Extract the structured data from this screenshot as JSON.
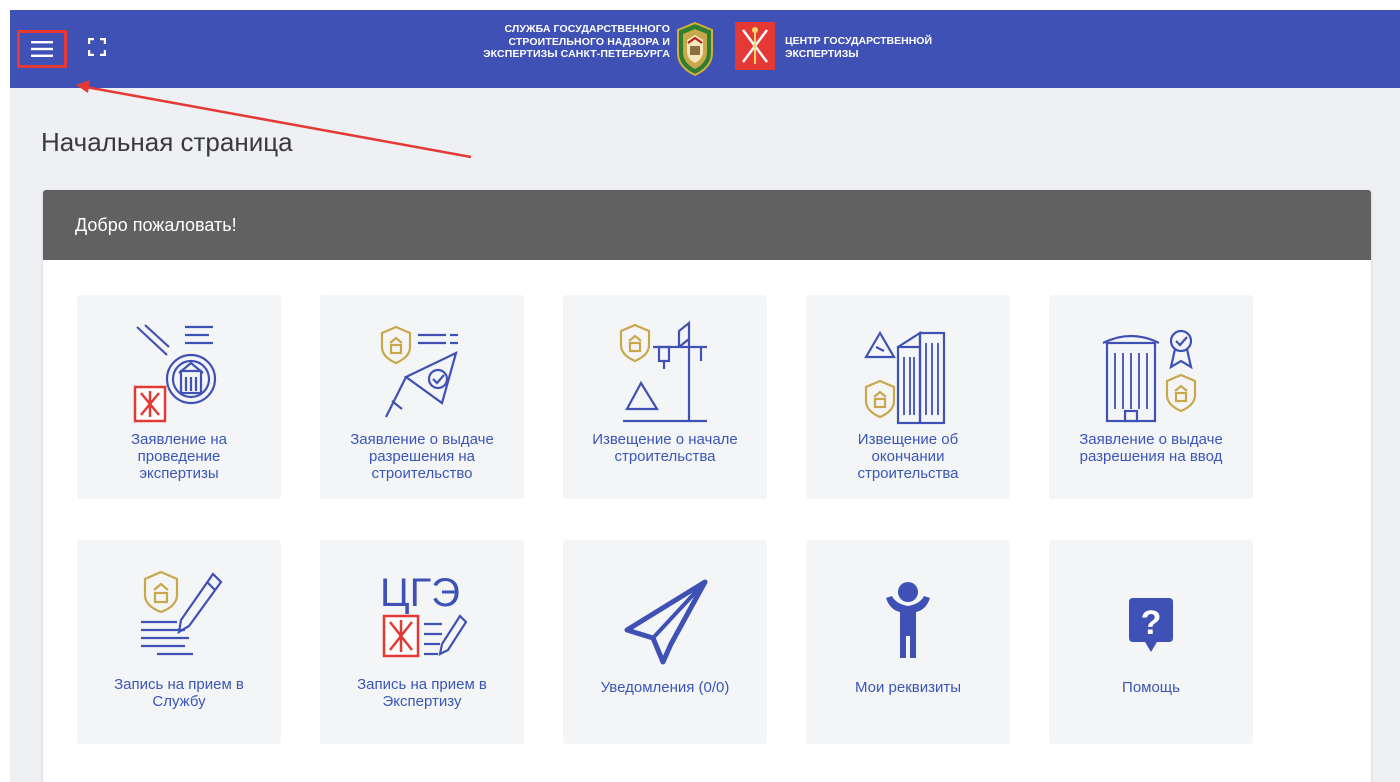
{
  "header": {
    "brand_left_line1": "СЛУЖБА ГОСУДАРСТВЕННОГО",
    "brand_left_line2": "СТРОИТЕЛЬНОГО НАДЗОРА И",
    "brand_left_line3": "ЭКСПЕРТИЗЫ САНКТ-ПЕТЕРБУРГА",
    "brand_right_line1": "ЦЕНТР ГОСУДАРСТВЕННОЙ",
    "brand_right_line2": "ЭКСПЕРТИЗЫ",
    "menu_icon": "hamburger-menu-icon",
    "fullscreen_icon": "fullscreen-icon",
    "color": "#3f51b5"
  },
  "page": {
    "title": "Начальная страница"
  },
  "panel": {
    "title": "Добро пожаловать!",
    "header_color": "#616161"
  },
  "tiles": [
    {
      "l1": "Заявление на",
      "l2": "проведение",
      "l3": "экспертизы",
      "icon": "expertise-application-icon"
    },
    {
      "l1": "Заявление о выдаче",
      "l2": "разрешения на",
      "l3": "строительство",
      "icon": "construction-permit-icon"
    },
    {
      "l1": "Извещение о начале",
      "l2": "строительства",
      "icon": "construction-start-icon"
    },
    {
      "l1": "Извещение об",
      "l2": "окончании",
      "l3": "строительства",
      "icon": "construction-end-icon"
    },
    {
      "l1": "Заявление о выдаче",
      "l2": "разрешения на ввод",
      "icon": "commissioning-permit-icon"
    },
    {
      "l1": "Запись на прием в",
      "l2": "Службу",
      "icon": "service-appointment-icon"
    },
    {
      "l1": "Запись на прием в",
      "l2": "Экспертизу",
      "icon": "expertise-appointment-icon",
      "icon_text": "ЦГЭ"
    },
    {
      "l1": "Уведомления (0/0)",
      "icon": "paper-plane-icon"
    },
    {
      "l1": "Мои реквизиты",
      "icon": "person-icon"
    },
    {
      "l1": "Помощь",
      "icon": "help-icon",
      "icon_text": "?"
    }
  ],
  "colors": {
    "accent_blue": "#3f51b5",
    "link_blue": "#3a56b8",
    "gold": "#c9a84c",
    "red": "#e53935"
  }
}
